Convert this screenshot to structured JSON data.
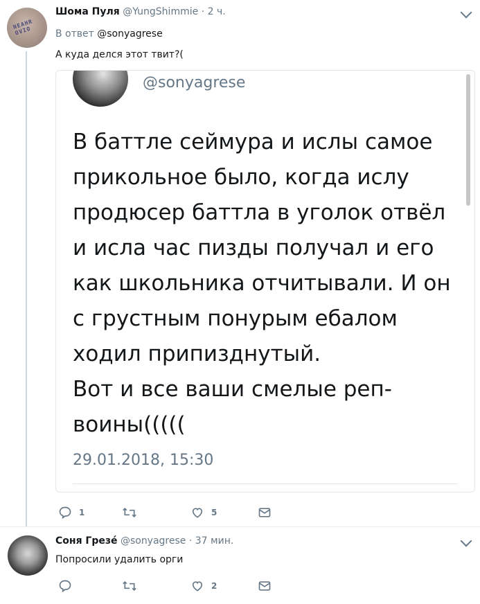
{
  "tweets": [
    {
      "name": "Шома Пуля",
      "handle": "@YungShimmie",
      "time": "2 ч.",
      "reply_prefix": "В ответ",
      "reply_to": "@sonyagrese",
      "text": "А куда делся этот твит?(",
      "avatar_text": "NEAHR OVIO",
      "quoted": {
        "handle": "@sonyagrese",
        "text": "В баттле сеймура и ислы самое прикольное было, когда ислу продюсер баттла в уголок отвёл и исла час пизды получал и его как школьника отчитывали. И он с грустным понурым ебалом ходил припизднутый.\nВот и все ваши смелые реп-воины(((((",
        "date": "29.01.2018, 15:30"
      },
      "actions": {
        "reply": "1",
        "retweet": "",
        "like": "5"
      }
    },
    {
      "name": "Соня Грезé",
      "handle": "@sonyagrese",
      "time": "37 мин.",
      "text": "Попросили удалить орги",
      "actions": {
        "reply": "",
        "retweet": "",
        "like": "2"
      }
    }
  ],
  "icons": {
    "reply": "reply-icon",
    "retweet": "retweet-icon",
    "like": "like-icon",
    "dm": "dm-icon",
    "more": "chevron-down-icon"
  },
  "colors": {
    "text": "#14171a",
    "muted": "#657786",
    "border": "#e6ecf0"
  }
}
